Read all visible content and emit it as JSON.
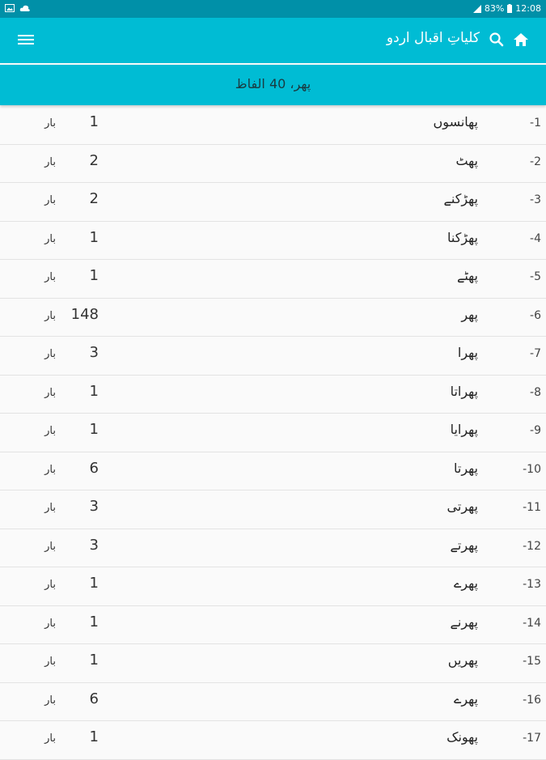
{
  "statusbar": {
    "battery": "83%",
    "time": "12:08"
  },
  "appbar": {
    "title": "کلیاتِ اقبال اردو"
  },
  "subheader": {
    "text": "پھر، 40 الفاظ"
  },
  "icons": {
    "menu": "menu-icon",
    "search": "search-icon",
    "home": "home-icon"
  },
  "rows": [
    {
      "num": "-1",
      "word": "پھانسوں",
      "count": "1",
      "unit": "بار"
    },
    {
      "num": "-2",
      "word": "پھٹ",
      "count": "2",
      "unit": "بار"
    },
    {
      "num": "-3",
      "word": "پھڑکنے",
      "count": "2",
      "unit": "بار"
    },
    {
      "num": "-4",
      "word": "پھڑکنا",
      "count": "1",
      "unit": "بار"
    },
    {
      "num": "-5",
      "word": "پھٹے",
      "count": "1",
      "unit": "بار"
    },
    {
      "num": "-6",
      "word": "پھر",
      "count": "148",
      "unit": "بار"
    },
    {
      "num": "-7",
      "word": "پھرا",
      "count": "3",
      "unit": "بار"
    },
    {
      "num": "-8",
      "word": "پھراتا",
      "count": "1",
      "unit": "بار"
    },
    {
      "num": "-9",
      "word": "پھرایا",
      "count": "1",
      "unit": "بار"
    },
    {
      "num": "-10",
      "word": "پھرتا",
      "count": "6",
      "unit": "بار"
    },
    {
      "num": "-11",
      "word": "پھرتی",
      "count": "3",
      "unit": "بار"
    },
    {
      "num": "-12",
      "word": "پھرتے",
      "count": "3",
      "unit": "بار"
    },
    {
      "num": "-13",
      "word": "پھرے",
      "count": "1",
      "unit": "بار"
    },
    {
      "num": "-14",
      "word": "پھرنے",
      "count": "1",
      "unit": "بار"
    },
    {
      "num": "-15",
      "word": "پھریں",
      "count": "1",
      "unit": "بار"
    },
    {
      "num": "-16",
      "word": "پھرے",
      "count": "6",
      "unit": "بار"
    },
    {
      "num": "-17",
      "word": "پھونک",
      "count": "1",
      "unit": "بار"
    }
  ]
}
